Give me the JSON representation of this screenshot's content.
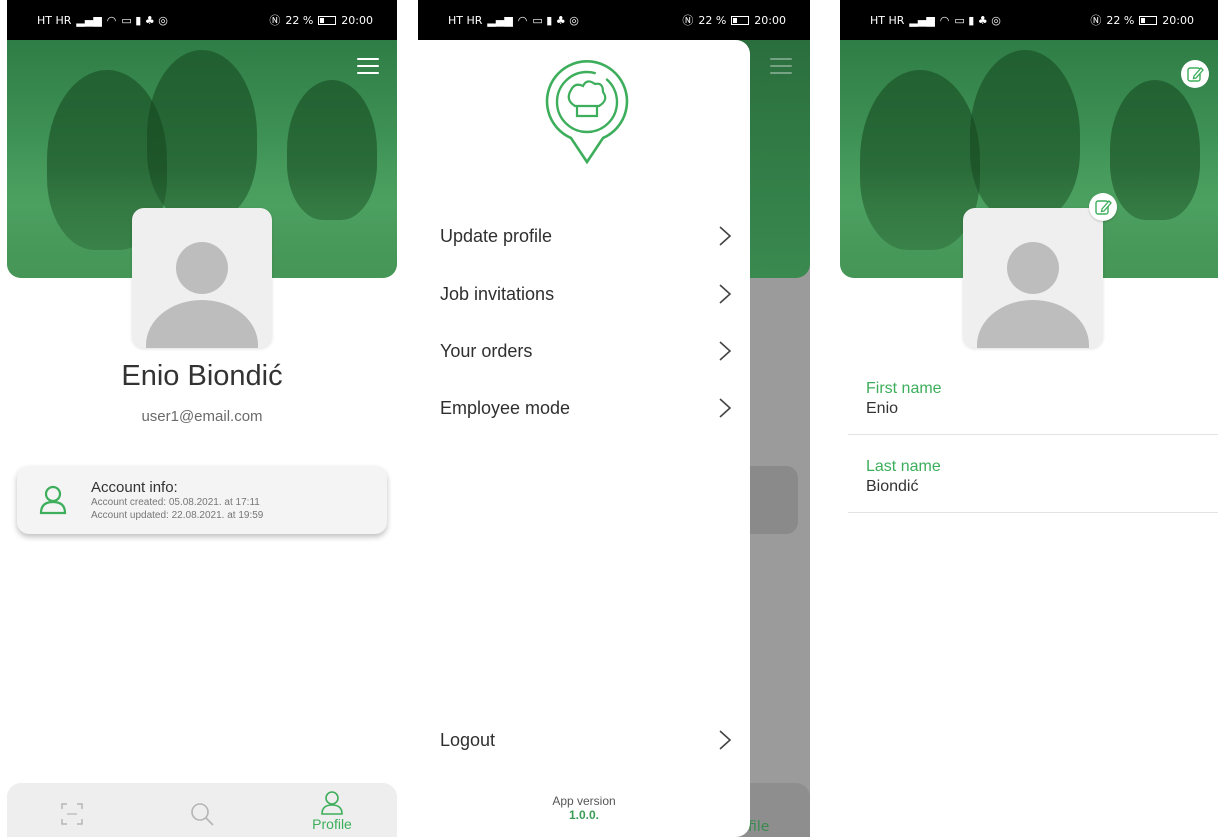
{
  "status_bar": {
    "carrier": "HT HR",
    "battery": "22 %",
    "time": "20:00"
  },
  "profile_screen": {
    "name": "Enio Biondić",
    "email": "user1@email.com",
    "account_card": {
      "title": "Account info:",
      "created": "Account created:   05.08.2021. at 17:11",
      "updated": "Account updated:  22.08.2021. at 19:59"
    },
    "bottom_nav": {
      "profile_label": "Profile"
    }
  },
  "drawer": {
    "items": [
      {
        "label": "Update profile"
      },
      {
        "label": "Job invitations"
      },
      {
        "label": "Your orders"
      },
      {
        "label": "Employee mode"
      }
    ],
    "logout_label": "Logout",
    "app_version_label": "App version",
    "app_version": "1.0.0.",
    "background_nav_label": "file"
  },
  "edit_screen": {
    "fields": [
      {
        "label": "First name",
        "value": "Enio"
      },
      {
        "label": "Last name",
        "value": "Biondić"
      }
    ]
  },
  "colors": {
    "accent": "#3dae5b",
    "banner": "#3e9155",
    "background": "#ffffff"
  },
  "icons": [
    "hamburger-menu-icon",
    "person-icon",
    "scan-icon",
    "search-icon",
    "profile-icon",
    "chef-hat-logo-icon",
    "chevron-right-icon",
    "edit-icon"
  ]
}
